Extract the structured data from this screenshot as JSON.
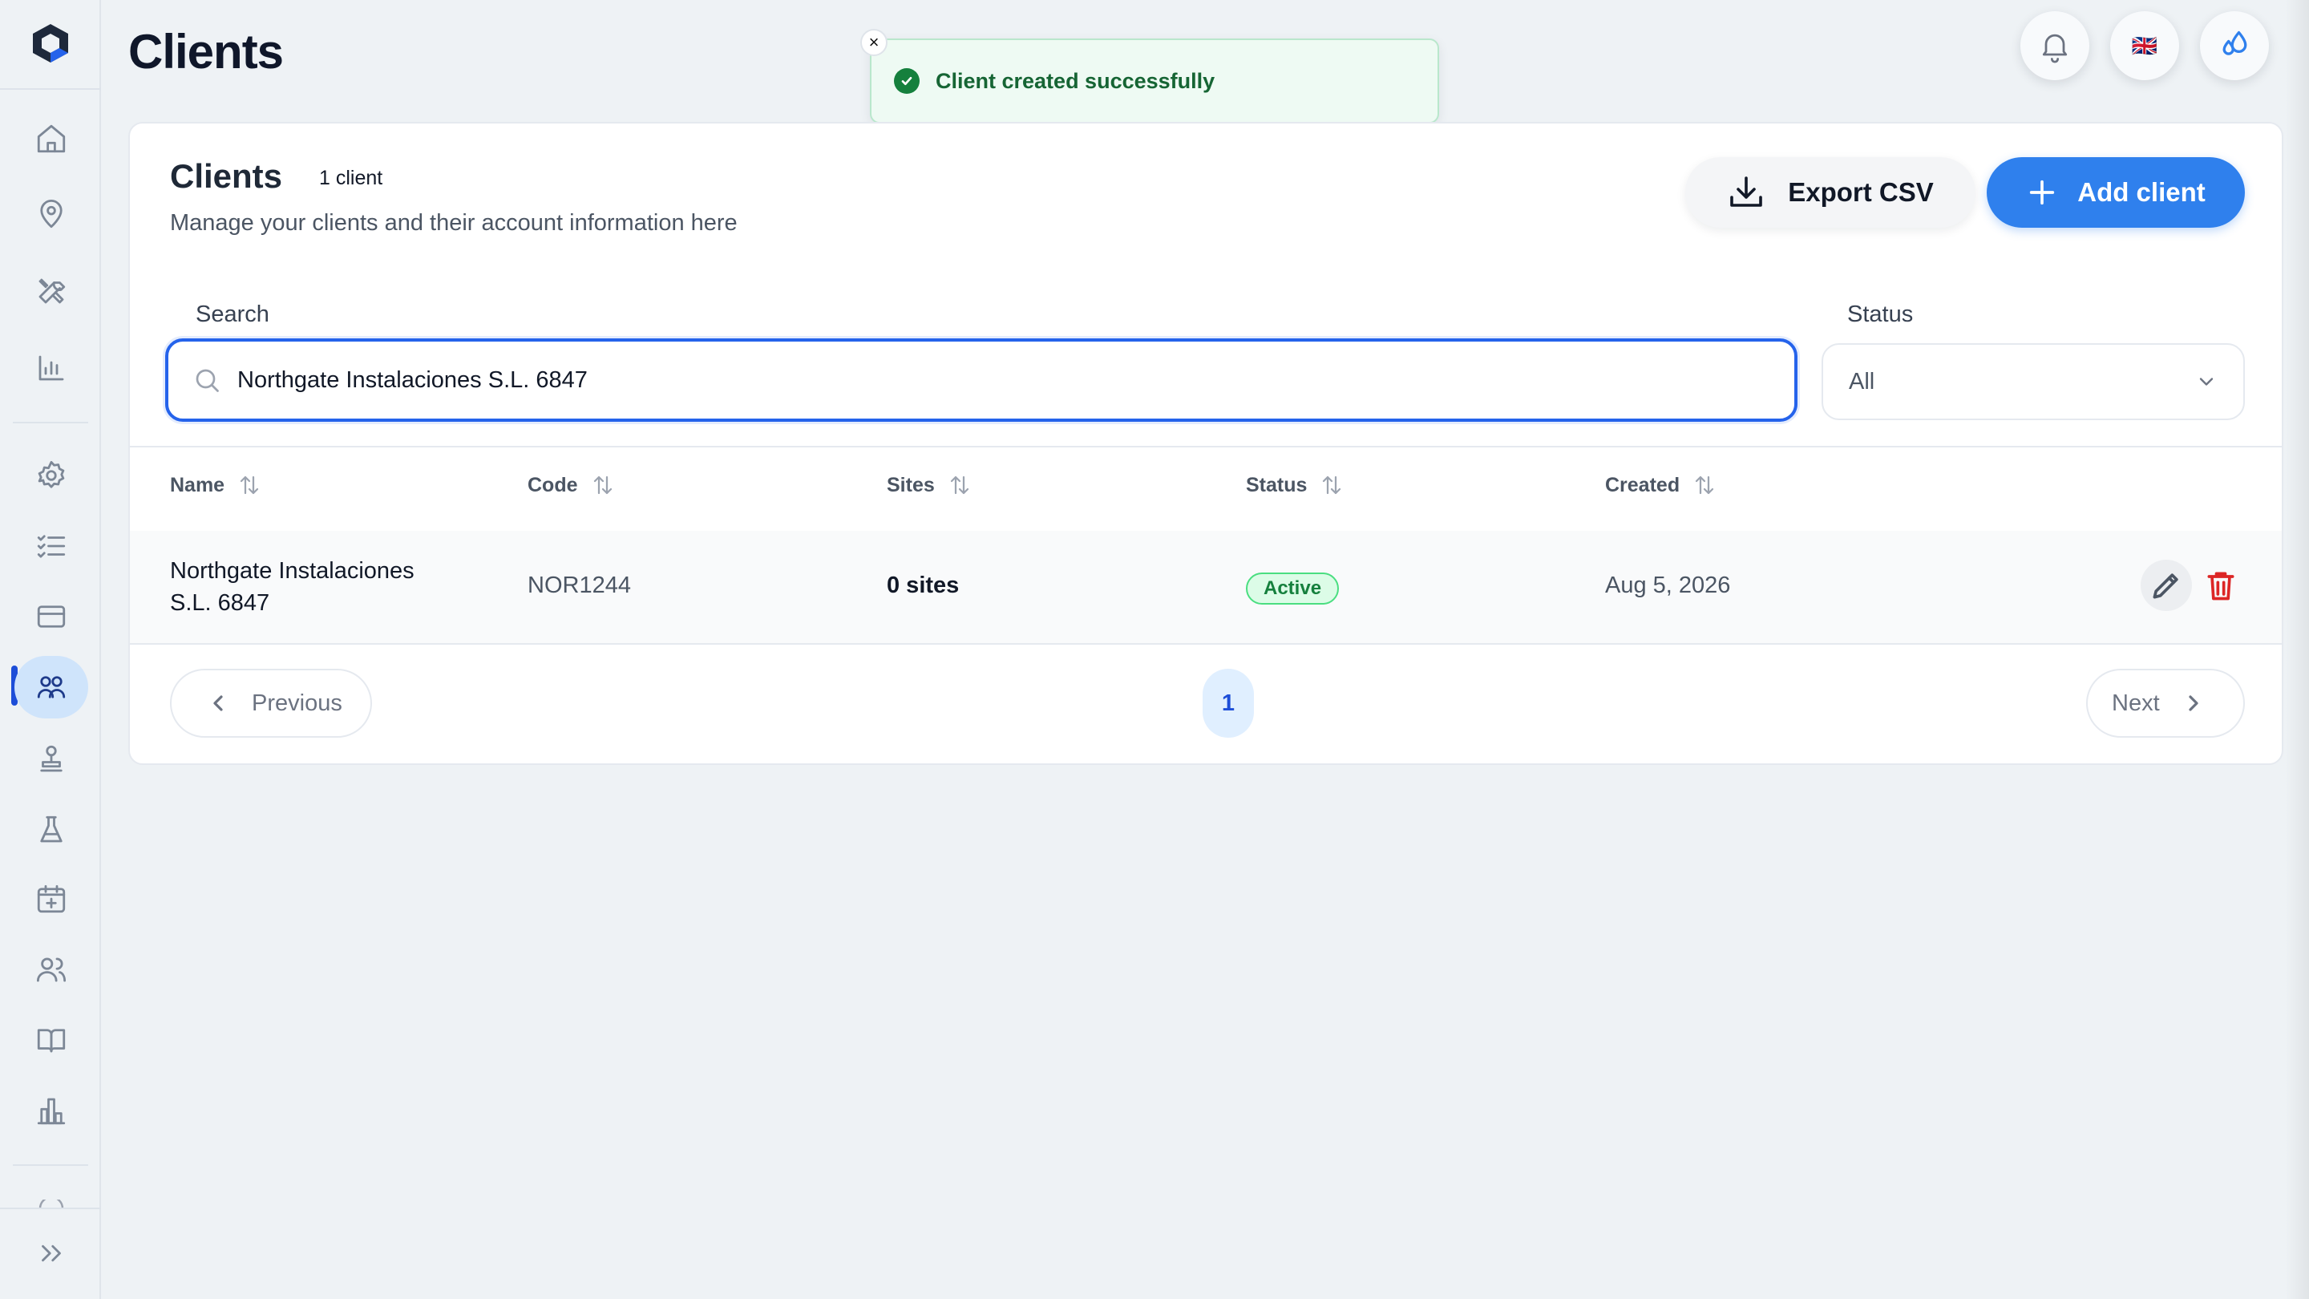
{
  "header": {
    "title": "Clients"
  },
  "toast": {
    "message": "Client created successfully",
    "close_label": "×"
  },
  "card": {
    "title": "Clients",
    "count": "1 client",
    "subtitle": "Manage your clients and their account information here",
    "export_label": "Export CSV",
    "add_label": "Add client"
  },
  "filters": {
    "search_label": "Search",
    "search_value": "Northgate Instalaciones S.L. 6847",
    "status_label": "Status",
    "status_value": "All"
  },
  "table": {
    "columns": [
      "Name",
      "Code",
      "Sites",
      "Status",
      "Created"
    ],
    "rows": [
      {
        "name_line1": "Northgate Instalaciones",
        "name_line2": "S.L. 6847",
        "code": "NOR1244",
        "sites": "0 sites",
        "status": "Active",
        "created": "Aug 5, 2026"
      }
    ]
  },
  "pagination": {
    "previous": "Previous",
    "current": "1",
    "next": "Next"
  },
  "language_flag": "🇬🇧",
  "colors": {
    "accent": "#2f80ed",
    "active_status": "#15803d",
    "danger": "#dc2626"
  }
}
